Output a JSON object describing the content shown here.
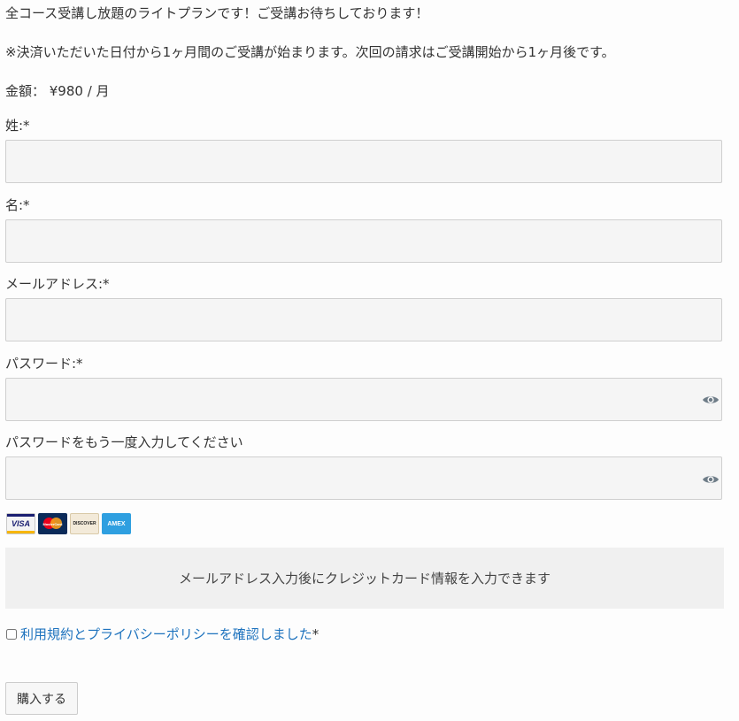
{
  "intro": {
    "line1": "全コース受講し放題のライトプランです！ご受講お待ちしております！",
    "line2": "※決済いただいた日付から1ヶ月間のご受講が始まります。次回の請求はご受講開始から1ヶ月後です。",
    "price": "金額： ¥980 / 月"
  },
  "form": {
    "last_name_label": "姓:*",
    "last_name_value": "",
    "first_name_label": "名:*",
    "first_name_value": "",
    "email_label": "メールアドレス:*",
    "email_value": "",
    "password_label": "パスワード:*",
    "password_value": "",
    "password_confirm_label": "パスワードをもう一度入力してください",
    "password_confirm_value": ""
  },
  "cards": [
    {
      "name": "VISA",
      "icon": "visa-card-icon"
    },
    {
      "name": "MasterCard",
      "icon": "mastercard-card-icon"
    },
    {
      "name": "DISCOVER",
      "icon": "discover-card-icon"
    },
    {
      "name": "AMEX",
      "icon": "amex-card-icon"
    }
  ],
  "card_notice": "メールアドレス入力後にクレジットカード情報を入力できます",
  "agreement": {
    "link_text": "利用規約とプライバシーポリシーを確認しました",
    "required_mark": "*",
    "checked": false
  },
  "submit_label": "購入する",
  "colors": {
    "link": "#1e73be",
    "input_bg": "#f5f5f5",
    "notice_bg": "#f0f0f0"
  }
}
